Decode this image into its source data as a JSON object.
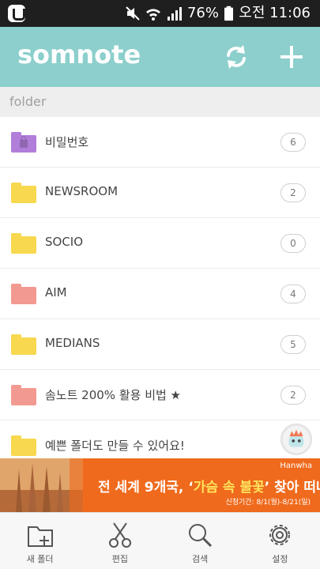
{
  "status_bar": {
    "battery": "76%",
    "time": "오전 11:06",
    "icons": [
      "app-icon",
      "mute-icon",
      "wifi-icon",
      "signal-icon",
      "battery-icon"
    ]
  },
  "header": {
    "logo": "somnote",
    "sync_icon": "sync-icon",
    "add_icon": "plus-icon",
    "accent": "#8ccfcc"
  },
  "section": {
    "label": "folder"
  },
  "folders": [
    {
      "name": "비밀번호",
      "count": "6",
      "color": "#b17ed9",
      "locked": true
    },
    {
      "name": "NEWSROOM",
      "count": "2",
      "color": "#f7d84f"
    },
    {
      "name": "SOCIO",
      "count": "0",
      "color": "#f7d84f"
    },
    {
      "name": "AIM",
      "count": "4",
      "color": "#f29a91"
    },
    {
      "name": "MEDIANS",
      "count": "5",
      "color": "#f7d84f"
    },
    {
      "name": "솜노트 200% 활용 비법 ★",
      "count": "2",
      "color": "#f29a91"
    },
    {
      "name": "예쁜 폴더도 만들 수 있어요!",
      "count": "",
      "color": "#f7d84f"
    }
  ],
  "ad": {
    "brand": "Hanwha",
    "title_pre": "전 세계 9개국, ‘",
    "title_highlight": "가슴 속 불꽃",
    "title_post": "’ 찾아 떠나자",
    "period": "신청기간: 8/1(월)-8/21(일)",
    "color": "#ef6a1c"
  },
  "bottom_nav": [
    {
      "label": "새 폴더",
      "icon": "new-folder-icon"
    },
    {
      "label": "편집",
      "icon": "scissors-icon"
    },
    {
      "label": "검색",
      "icon": "search-icon"
    },
    {
      "label": "설정",
      "icon": "gear-icon"
    }
  ]
}
